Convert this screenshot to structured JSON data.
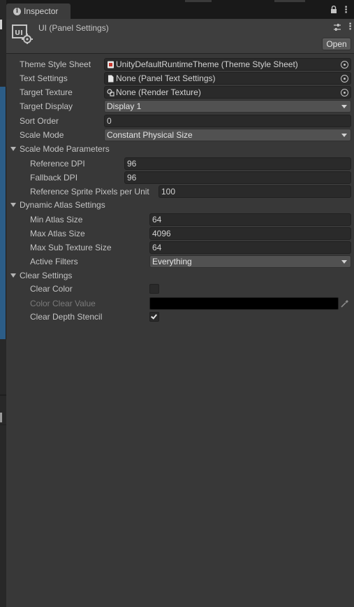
{
  "tab": {
    "title": "Inspector"
  },
  "header": {
    "title": "UI (Panel Settings)",
    "open_label": "Open"
  },
  "fields": {
    "theme_style_sheet": {
      "label": "Theme Style Sheet",
      "value": "UnityDefaultRuntimeTheme (Theme Style Sheet)"
    },
    "text_settings": {
      "label": "Text Settings",
      "value": "None (Panel Text Settings)"
    },
    "target_texture": {
      "label": "Target Texture",
      "value": "None (Render Texture)"
    },
    "target_display": {
      "label": "Target Display",
      "value": "Display 1"
    },
    "sort_order": {
      "label": "Sort Order",
      "value": "0"
    },
    "scale_mode": {
      "label": "Scale Mode",
      "value": "Constant Physical Size"
    }
  },
  "scale_mode_params": {
    "label": "Scale Mode Parameters",
    "reference_dpi": {
      "label": "Reference DPI",
      "value": "96"
    },
    "fallback_dpi": {
      "label": "Fallback DPI",
      "value": "96"
    },
    "reference_sprite_ppu": {
      "label": "Reference Sprite Pixels per Unit",
      "value": "100"
    }
  },
  "dynamic_atlas": {
    "label": "Dynamic Atlas Settings",
    "min_atlas_size": {
      "label": "Min Atlas Size",
      "value": "64"
    },
    "max_atlas_size": {
      "label": "Max Atlas Size",
      "value": "4096"
    },
    "max_sub_texture_size": {
      "label": "Max Sub Texture Size",
      "value": "64"
    },
    "active_filters": {
      "label": "Active Filters",
      "value": "Everything"
    }
  },
  "clear_settings": {
    "label": "Clear Settings",
    "clear_color": {
      "label": "Clear Color",
      "checked": false
    },
    "color_clear_value": {
      "label": "Color Clear Value",
      "color": "#000000"
    },
    "clear_depth_stencil": {
      "label": "Clear Depth Stencil",
      "checked": true
    }
  }
}
